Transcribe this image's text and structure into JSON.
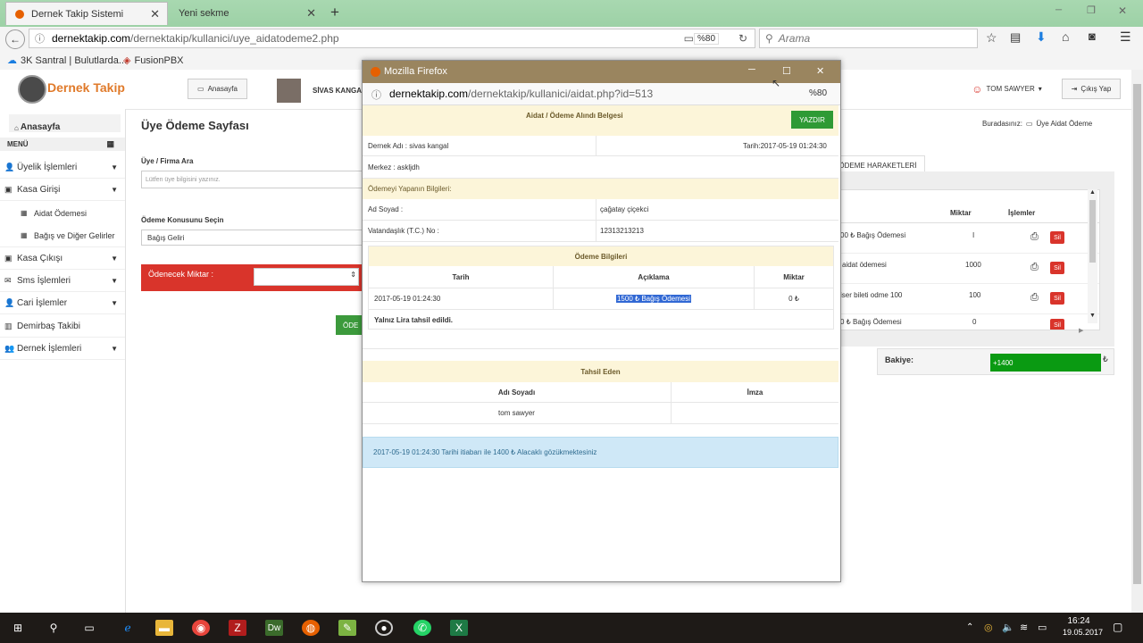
{
  "browser": {
    "tabs": [
      {
        "label": "Dernek Takip Sistemi"
      },
      {
        "label": "Yeni sekme"
      }
    ],
    "url_domain": "dernektakip.com",
    "url_path": "/dernektakip/kullanici/uye_aidatodeme2.php",
    "zoom": "%80",
    "search_placeholder": "Arama",
    "bookmarks": [
      {
        "label": "3K Santral | Bulutlarda..."
      },
      {
        "label": "FusionPBX"
      }
    ],
    "new_tab": "+",
    "close_glyph": "✕"
  },
  "header": {
    "logo_text": "Dernek Takip",
    "home_button": "Anasayfa",
    "org_name": "SİVAS KANGAL",
    "user_name": "TOM SAWYER",
    "logout": "Çıkış Yap"
  },
  "sidebar": {
    "home": "Anasayfa",
    "menu_label": "MENÜ",
    "items": [
      {
        "label": "Üyelik İşlemleri"
      },
      {
        "label": "Kasa Girişi"
      },
      {
        "label": "Aidat Ödemesi"
      },
      {
        "label": "Bağış ve Diğer Gelirler"
      },
      {
        "label": "Kasa Çıkışı"
      },
      {
        "label": "Sms İşlemleri"
      },
      {
        "label": "Cari İşlemler"
      },
      {
        "label": "Demirbaş Takibi"
      },
      {
        "label": "Dernek İşlemleri"
      }
    ]
  },
  "main": {
    "page_title": "Üye Ödeme Sayfası",
    "breadcrumb_label": "Buradasınız:",
    "breadcrumb_item": "Üye Aidat Ödeme",
    "member_search_label": "Üye / Firma Ara",
    "member_search_placeholder": "Lütfen üye bilgisini yazınız.",
    "payment_topic_label": "Ödeme Konusunu Seçin",
    "payment_topic_value": "Bağış Geliri",
    "amount_label": "Ödenecek Miktar :",
    "pay_button": "ÖDE",
    "history_tab": "ÖDEME HARAKETLERİ",
    "table": {
      "col_amount": "Miktar",
      "col_actions": "İşlemler",
      "delete_label": "Sil",
      "rows": [
        {
          "desc": "00 ₺ Bağış Ödemesi",
          "amount": "I"
        },
        {
          "desc": "aidat ödemesi",
          "amount": "1000"
        },
        {
          "desc": "iser bileti odme 100",
          "amount": "100"
        },
        {
          "desc": "0 ₺ Bağış Ödemesi",
          "amount": "0"
        }
      ]
    },
    "balance_label": "Bakiye:",
    "balance_value": "+1400",
    "currency": "₺"
  },
  "popup": {
    "window_title": "Mozilla Firefox",
    "url_domain": "dernektakip.com",
    "url_path": "/dernektakip/kullanici/aidat.php?id=513",
    "zoom": "%80",
    "receipt_title": "Aidat / Ödeme Alındı Belgesi",
    "print_button": "YAZDIR",
    "org_line": "Dernek Adı : sivas kangal",
    "date_line": "Tarih:2017-05-19 01:24:30",
    "center_line": "Merkez : askljdh",
    "payer_section": "Ödemeyi Yapanın Bilgileri:",
    "name_label": "Ad Soyad :",
    "name_value": "çağatay çiçekci",
    "tc_label": "Vatandaşlık (T.C.) No :",
    "tc_value": "12313213213",
    "payment_section": "Ödeme Bilgileri",
    "col_date": "Tarih",
    "col_desc": "Açıklama",
    "col_amount": "Miktar",
    "row_date": "2017-05-19 01:24:30",
    "row_desc": "1500 ₺ Bağış Ödemesi",
    "row_amount": "0 ₺",
    "collected_note": "Yalnız Lira tahsil edildi.",
    "collector_section": "Tahsil Eden",
    "col_collector_name": "Adı Soyadı",
    "col_signature": "İmza",
    "collector_name": "tom sawyer",
    "status_message": "2017-05-19 01:24:30 Tarihi itiabarı ile 1400 ₺ Alacaklı gözükmektesiniz"
  },
  "taskbar": {
    "time": "16:24",
    "date": "19.05.2017"
  }
}
